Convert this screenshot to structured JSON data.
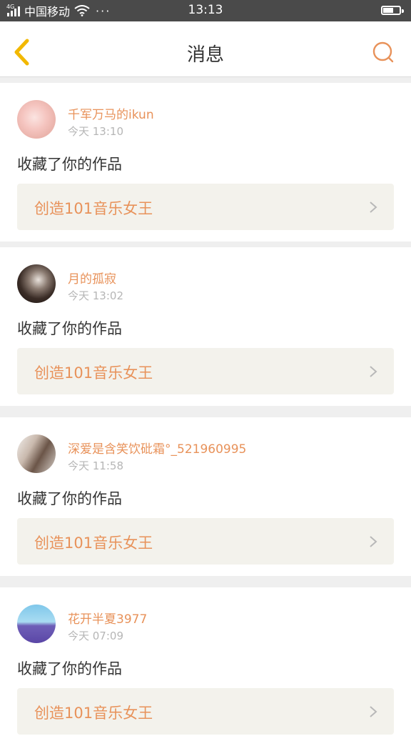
{
  "status_bar": {
    "network": "4G",
    "carrier": "中国移动",
    "more": "···",
    "time": "13:13"
  },
  "header": {
    "title": "消息",
    "back_icon": "chevron-left-icon",
    "search_icon": "search-icon"
  },
  "colors": {
    "accent": "#e8925a",
    "back_arrow": "#f2b800",
    "status_bar": "#4a4a4a",
    "card_link_bg": "#f3f2ec"
  },
  "messages": [
    {
      "user": "千军万马的ikun",
      "time": "今天 13:10",
      "action": "收藏了你的作品",
      "work": "创造101音乐女王"
    },
    {
      "user": "月的孤寂",
      "time": "今天 13:02",
      "action": "收藏了你的作品",
      "work": "创造101音乐女王"
    },
    {
      "user": "深爱是含笑饮砒霜°_521960995",
      "time": "今天 11:58",
      "action": "收藏了你的作品",
      "work": "创造101音乐女王"
    },
    {
      "user": "花开半夏3977",
      "time": "今天 07:09",
      "action": "收藏了你的作品",
      "work": "创造101音乐女王"
    }
  ]
}
